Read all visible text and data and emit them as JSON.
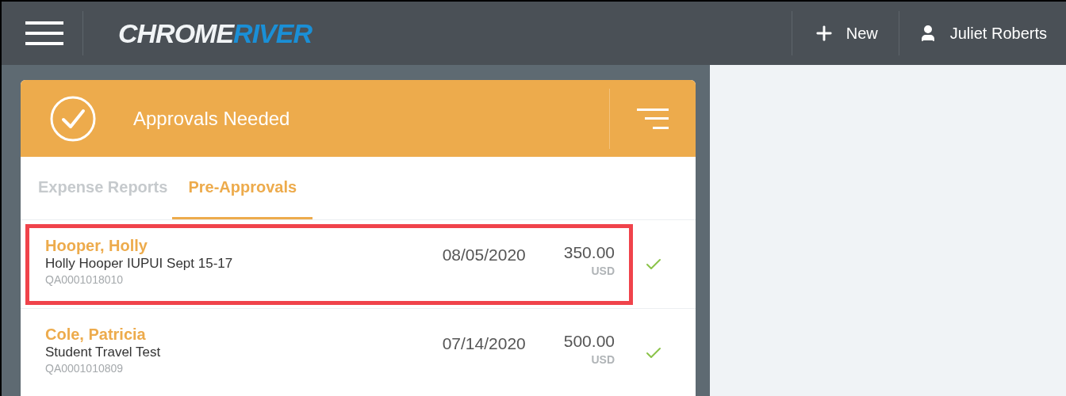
{
  "header": {
    "logo": {
      "first": "CHROME",
      "second": "RIVER"
    },
    "new_label": "New",
    "user_name": "Juliet Roberts"
  },
  "panel": {
    "title": "Approvals Needed"
  },
  "tabs": [
    {
      "label": "Expense Reports",
      "selected": false
    },
    {
      "label": "Pre-Approvals",
      "selected": true
    }
  ],
  "rows": [
    {
      "name": "Hooper, Holly",
      "description": "Holly Hooper IUPUI Sept 15-17",
      "id": "QA0001018010",
      "date": "08/05/2020",
      "amount": "350.00",
      "currency": "USD",
      "highlighted": true
    },
    {
      "name": "Cole, Patricia",
      "description": "Student Travel Test",
      "id": "QA0001010809",
      "date": "07/14/2020",
      "amount": "500.00",
      "currency": "USD",
      "highlighted": false
    }
  ]
}
